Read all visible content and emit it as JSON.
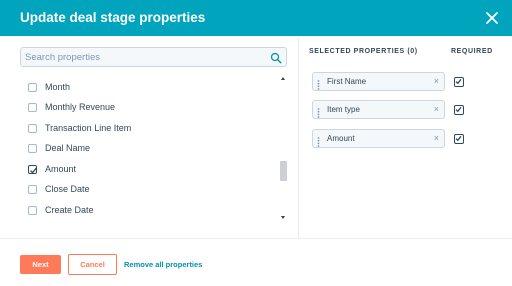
{
  "dialog": {
    "title": "Update deal stage properties"
  },
  "search": {
    "placeholder": "Search properties",
    "value": ""
  },
  "property_list": {
    "items": [
      {
        "label": "Month",
        "checked": false
      },
      {
        "label": "Monthly Revenue",
        "checked": false
      },
      {
        "label": "Transaction Line Item",
        "checked": false
      },
      {
        "label": "Deal Name",
        "checked": false
      },
      {
        "label": "Amount",
        "checked": true
      },
      {
        "label": "Close Date",
        "checked": false
      },
      {
        "label": "Create Date",
        "checked": false
      }
    ]
  },
  "selected": {
    "heading": "SELECTED PROPERTIES (0)",
    "required_heading": "REQUIRED",
    "items": [
      {
        "label": "First Name",
        "required": true
      },
      {
        "label": "Item type",
        "required": true
      },
      {
        "label": "Amount",
        "required": true
      }
    ]
  },
  "footer": {
    "next_label": "Next",
    "cancel_label": "Cancel",
    "remove_all_label": "Remove all properties"
  },
  "colors": {
    "header": "#00a4bd",
    "primary_button": "#ff7a59",
    "link": "#0091ae",
    "text": "#33475b"
  }
}
